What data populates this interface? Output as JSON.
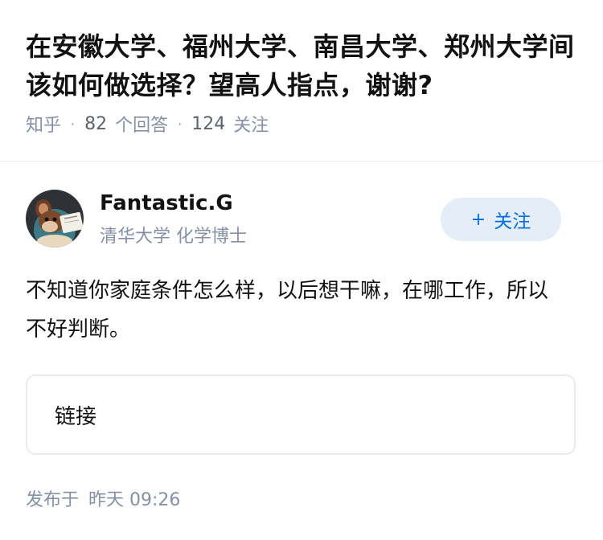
{
  "question": {
    "title": "在安徽大学、福州大学、南昌大学、郑州大学间该如何做选择？望高人指点，谢谢?",
    "source": "知乎",
    "answer_count": "82",
    "answer_label": "个回答",
    "follower_count": "124",
    "follower_label": "关注"
  },
  "author": {
    "name": "Fantastic.G",
    "bio": "清华大学 化学博士",
    "follow_label": "关注",
    "follow_icon": "plus-icon"
  },
  "answer": {
    "body": "不知道你家庭条件怎么样，以后想干嘛，在哪工作，所以不好判断。",
    "link_label": "链接"
  },
  "publish": {
    "prefix": "发布于",
    "time": "昨天 09:26"
  },
  "colors": {
    "accent": "#056de8",
    "follow_bg": "#e5eef8",
    "meta": "#8590a6"
  }
}
